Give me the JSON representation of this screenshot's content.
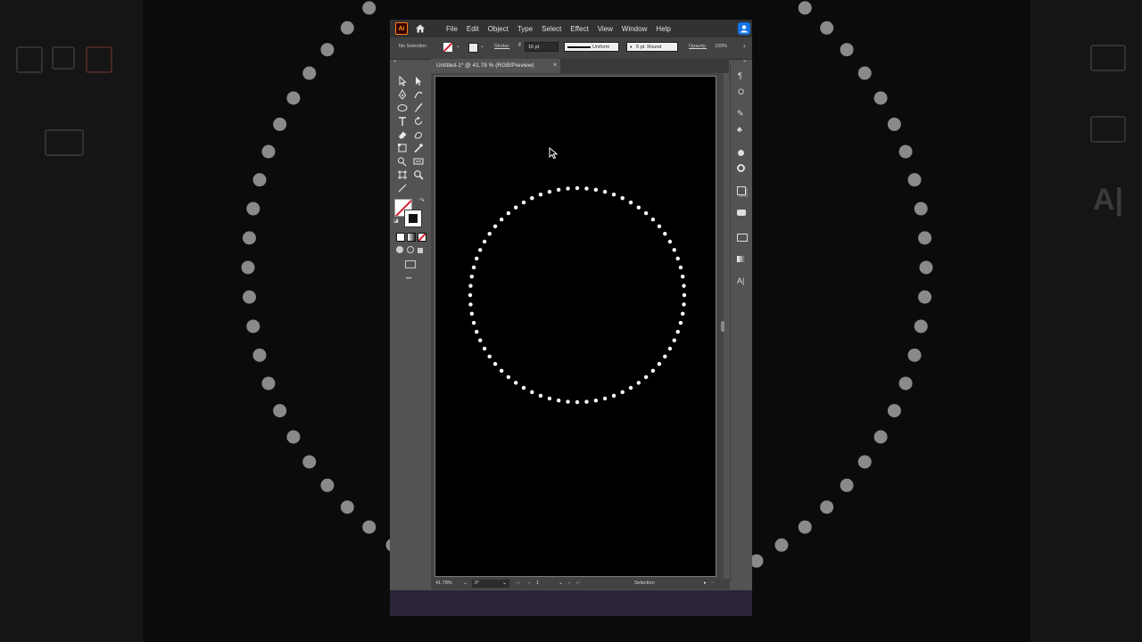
{
  "menubar": {
    "app_logo": "Ai",
    "items": [
      "File",
      "Edit",
      "Object",
      "Type",
      "Select",
      "Effect",
      "View",
      "Window",
      "Help"
    ]
  },
  "controlbar": {
    "selection_state": "No Selection",
    "stroke_label": "Stroke:",
    "stroke_value": "16 pt",
    "profile_value": "Uniform",
    "brush_value": "5 pt. Round",
    "opacity_label": "Opacity:",
    "opacity_value": "100%"
  },
  "document": {
    "tab_title": "Untitled-1* @ 41.78 % (RGB/Preview)",
    "close_glyph": "×"
  },
  "statusbar": {
    "zoom": "41.78%",
    "rotation": "0°",
    "artboard_number": "1",
    "tool_status": "Selection"
  },
  "toolbar": {
    "more_glyph": "•••"
  },
  "artwork": {
    "shape": "dotted-circle",
    "stroke_color": "#ffffff",
    "fill_color": "none",
    "dot_count": 72
  },
  "colors": {
    "accent": "#1473e6",
    "ui_bg": "#535353",
    "menubar_bg": "#323232",
    "artboard_bg": "#000000"
  }
}
